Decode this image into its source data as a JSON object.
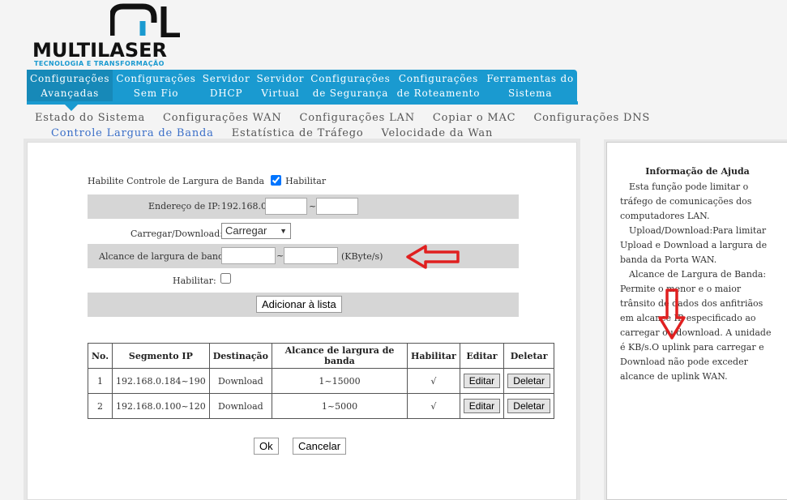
{
  "brand": {
    "name": "MULTILASER",
    "tagline": "TECNOLOGIA E TRANSFORMAÇÃO",
    "blue": "#1a9ad0"
  },
  "topnav": [
    {
      "label": "Configurações\nAvançadas"
    },
    {
      "label": "Configurações\nSem Fio"
    },
    {
      "label": "Servidor\nDHCP"
    },
    {
      "label": "Servidor\nVirtual"
    },
    {
      "label": "Configurações\nde Segurança"
    },
    {
      "label": "Configurações\nde Roteamento"
    },
    {
      "label": "Ferramentas do\nSistema"
    }
  ],
  "subnav": {
    "row1": [
      "Estado do Sistema",
      "Configurações WAN",
      "Configurações LAN",
      "Copiar o MAC",
      "Configurações DNS"
    ],
    "row2": [
      "Controle Largura de Banda",
      "Estatística de Tráfego",
      "Velocidade da Wan"
    ]
  },
  "form": {
    "enable_label": "Habilite Controle de Largura de Banda",
    "enable_check_label": "Habilitar",
    "enable_checked": true,
    "ip_label": "Endereço de IP:",
    "ip_prefix": "192.168.0.",
    "ip_sep": "~",
    "direction_label": "Carregar/Download:",
    "direction_value": "Carregar",
    "range_label": "Alcance de largura de banda:",
    "range_sep": "~",
    "range_unit": "(KByte/s)",
    "habilitar_label": "Habilitar:",
    "add_button": "Adicionar à lista"
  },
  "table": {
    "headers": [
      "No.",
      "Segmento IP",
      "Destinação",
      "Alcance de largura de banda",
      "Habilitar",
      "Editar",
      "Deletar"
    ],
    "rows": [
      {
        "no": "1",
        "ip": "192.168.0.184~190",
        "dest": "Download",
        "range": "1~15000",
        "enabled": "√",
        "edit": "Editar",
        "del": "Deletar"
      },
      {
        "no": "2",
        "ip": "192.168.0.100~120",
        "dest": "Download",
        "range": "1~5000",
        "enabled": "√",
        "edit": "Editar",
        "del": "Deletar"
      }
    ]
  },
  "actions": {
    "ok": "Ok",
    "cancel": "Cancelar"
  },
  "help": {
    "title": "Informação de Ajuda",
    "paragraphs": [
      "Esta função pode limitar o tráfego de comunicações dos computadores LAN.",
      "Upload/Download:Para limitar Upload e Download a largura de banda da Porta WAN.",
      "Alcance de Largura de Banda: Permite o menor e o maior trânsito de dados dos anfitriãos em alcance IP especificado ao carregar ou download. A unidade é KB/s.O uplink para carregar e Download não pode exceder alcance de uplink WAN."
    ]
  },
  "annotation_color": "#e02020"
}
